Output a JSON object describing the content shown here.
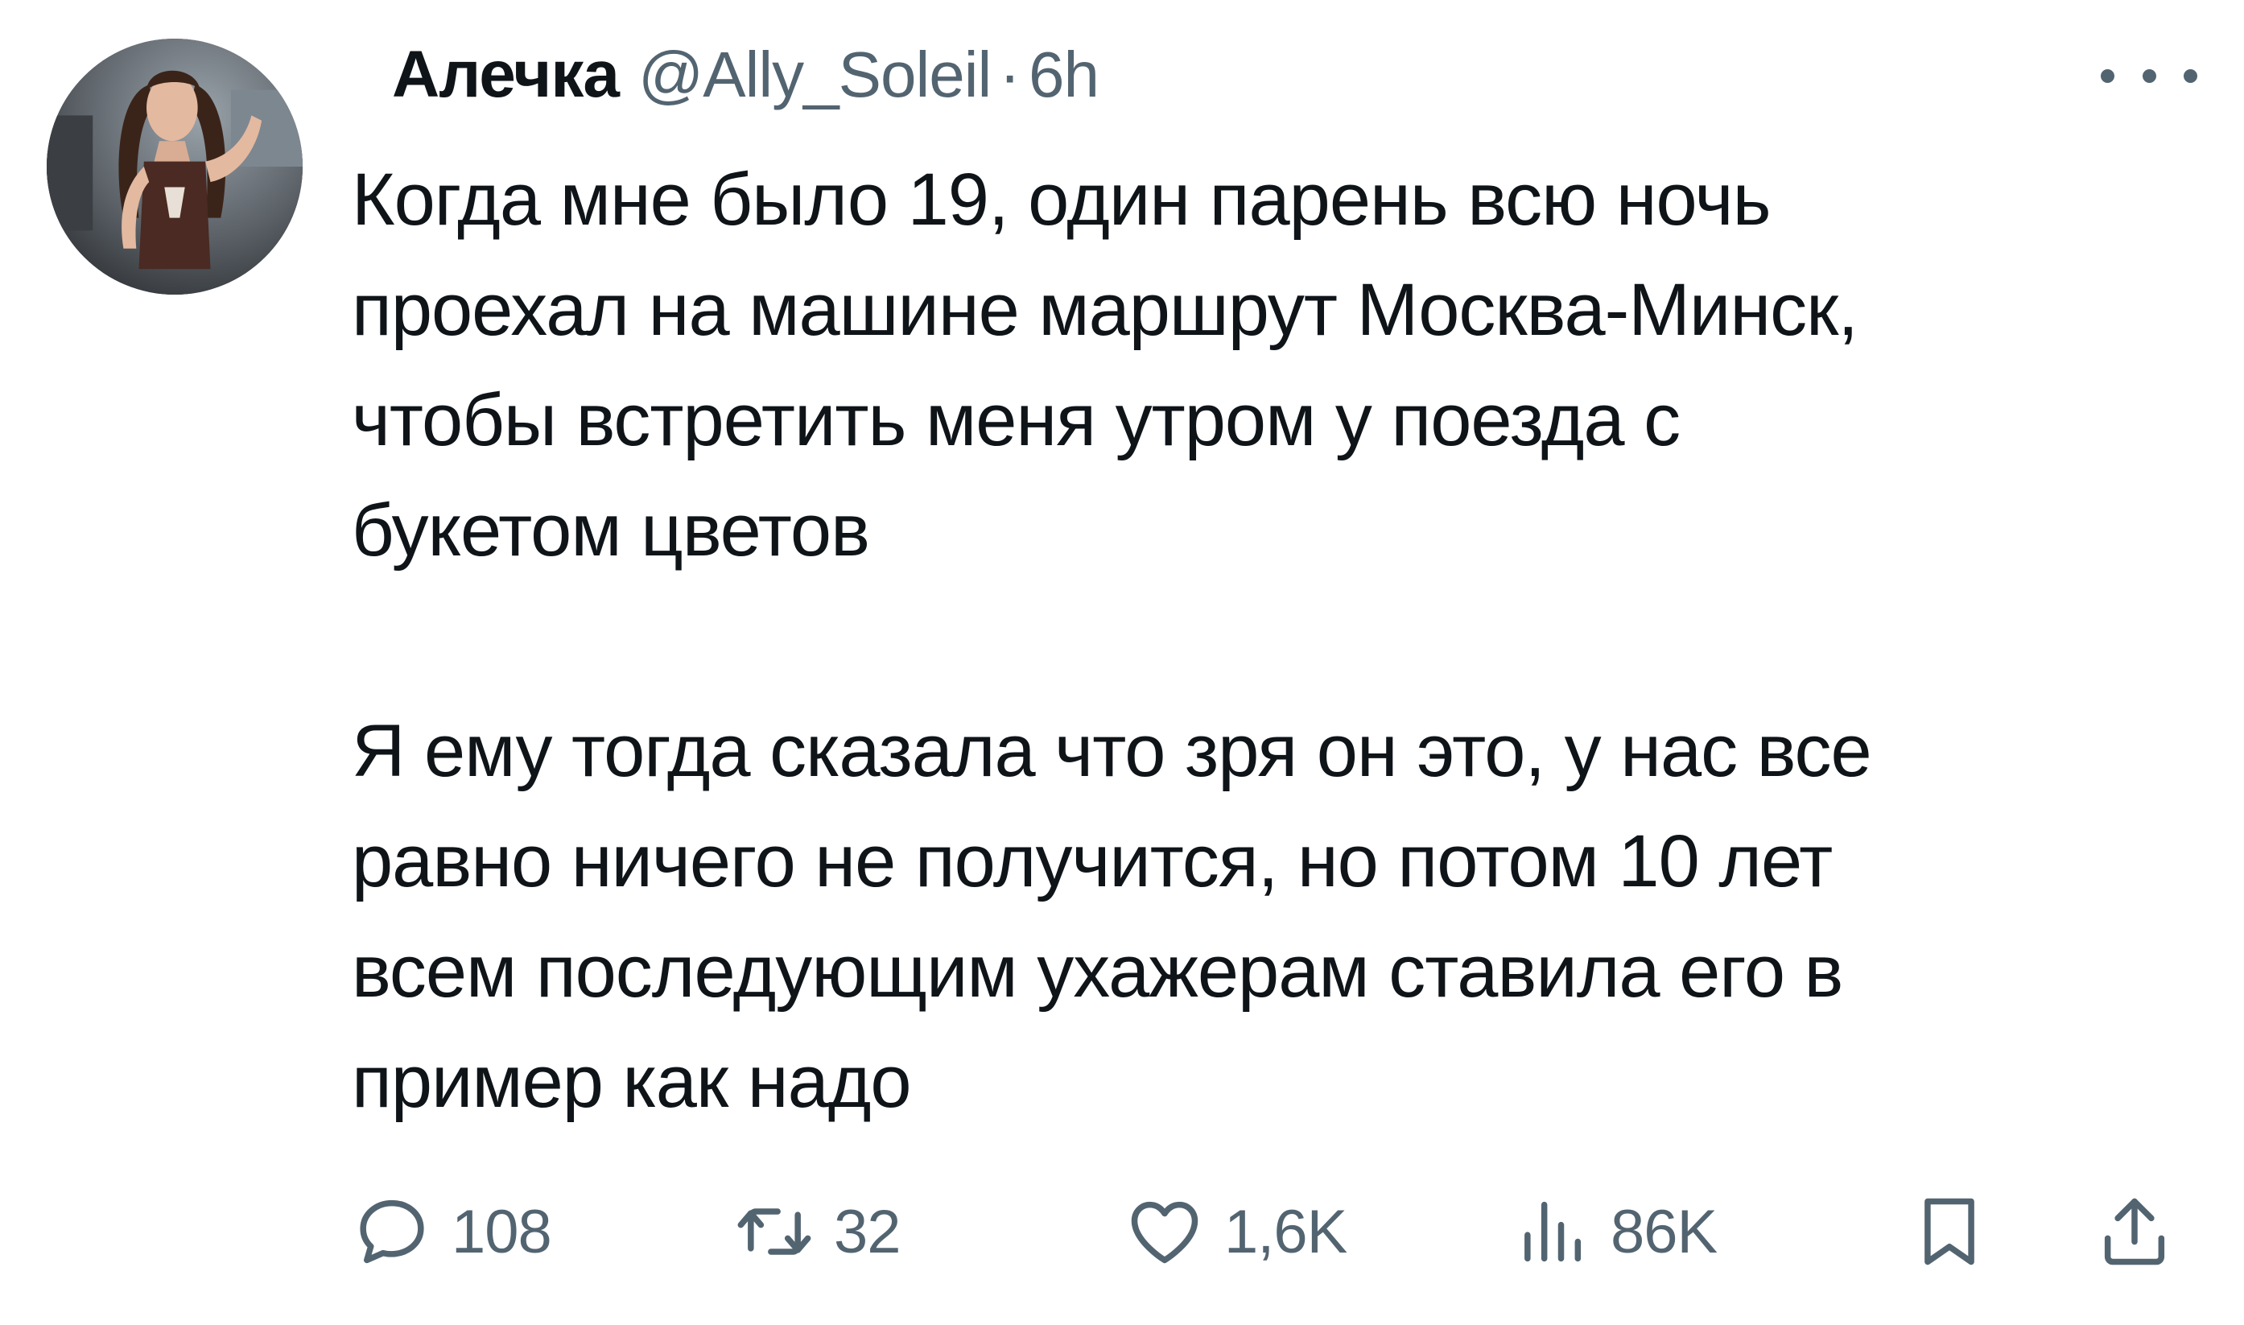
{
  "tweet": {
    "author": {
      "display_name": "Алечка",
      "handle": "@Ally_Soleil",
      "separator": "·",
      "time": "6h",
      "avatar_icon": "user-avatar"
    },
    "paragraphs": [
      "Когда мне было 19, один парень всю ночь\nпроехал на машине маршрут Москва-Минск,\nчтобы встретить меня утром у поезда с\nбукетом цветов",
      "Я ему тогда сказала что зря он это, у нас все\nравно ничего не получится, но потом 10 лет\nвсем последующим ухажерам ставила его в\nпример как надо"
    ],
    "actions": {
      "reply": {
        "icon": "reply-icon",
        "count": "108"
      },
      "retweet": {
        "icon": "retweet-icon",
        "count": "32"
      },
      "like": {
        "icon": "heart-icon",
        "count": "1,6K"
      },
      "views": {
        "icon": "views-icon",
        "count": "86K"
      },
      "bookmark": {
        "icon": "bookmark-icon"
      },
      "share": {
        "icon": "share-icon"
      }
    },
    "more_icon": "more-options-icon"
  },
  "colors": {
    "text_primary": "#0f1419",
    "text_secondary": "#536471",
    "background": "#ffffff"
  }
}
